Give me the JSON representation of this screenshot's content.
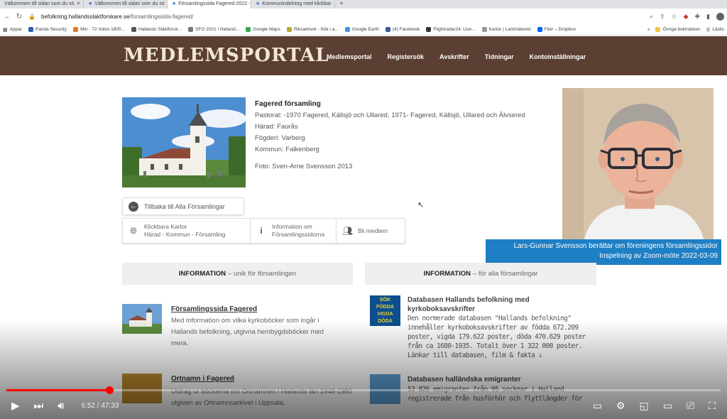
{
  "browser": {
    "tabs": [
      {
        "label": "Välkommen till sidan som du sö",
        "active": false
      },
      {
        "label": "Välkommen till sidan som du sö",
        "active": false
      },
      {
        "label": "Församlingssida Fagered-2022 -",
        "active": true
      },
      {
        "label": "Kommunindelning med klickbar",
        "active": false
      }
    ],
    "url_host": "befolkning.hallandsslaktforskare.se",
    "url_path": "/forsamlingssida-fagered/",
    "bookmarks": [
      "Appar",
      "Panda Security",
      "Min - 72 Volvo 1800...",
      "Hallands Släktforsk...",
      "SFO 2021 i Halland...",
      "Google Maps",
      "Riksarkivet - Sök i a...",
      "Google Earth",
      "(4) Facebook",
      "Flightradar24: Live...",
      "Kartor | Lantmäteriet",
      "Filer – Dropbox"
    ],
    "bookmarks_more": "»",
    "bookmarks_other": "Övriga bokmärken",
    "bookmarks_reading": "Läslis"
  },
  "site": {
    "logo": "MEDLEMSPORTAL",
    "nav": [
      "Medlemsportal",
      "Registersök",
      "Avskrifter",
      "Tidningar",
      "Kontoinställningar"
    ]
  },
  "parish": {
    "name": "Fagered församling",
    "pastorat": "Pastorat: -1970 Fagered, Källsjö och Ullared, 1971- Fagered, Källsjö, Ullared och Älvsered",
    "harad": "Härad: Faurås",
    "fogderi": "Fögderi: Varberg",
    "kommun": "Kommun: Falkenberg",
    "foto": "Foto: Sven-Arne Svensson 2013"
  },
  "buttons": {
    "back": "Tillbaka till Alla Församlingar",
    "maps_line1": "Klickbara Kartor",
    "maps_line2": "Härad - Kommun - Församling",
    "info_line1": "Information om",
    "info_line2": "Församlingssidorna",
    "member": "Bli medlem"
  },
  "presenter": {
    "caption_line1": "Lars-Gunnar Svensson berättar om föreningens församlingssidor",
    "caption_line2": "Inspelning av Zoom-möte 2022-03-09"
  },
  "columns": {
    "left_bold": "INFORMATION",
    "left_rest": "– unik för församlingen",
    "right_bold": "INFORMATION",
    "right_rest": "– för alla församlingar"
  },
  "left_items": [
    {
      "title": "Församlingssida Fagered",
      "desc": "Med information om vilka kyrkoböcker som ingår i Hallands befolkning, utgivna hembygdsböcker med mera."
    },
    {
      "title": "Ortnamn i Fagered ",
      "desc": "Utdrag ur böckerna om Ortnamnen i Hallands län 1948-1980 utgiven av Ortnamnsarkivet i Uppsala."
    }
  ],
  "right_items": [
    {
      "badge": [
        "SÖK",
        "FÖDDA",
        "VIGDA",
        "DÖDA"
      ],
      "title": "Databasen Hallands befolkning med kyrkoboksavskrifter",
      "desc": "Den normerade databasen \"Hallands befolkning\" innehåller kyrkoboksavskrifter av födda 672.209 poster, vigda 179.622 poster, döda 470.629 poster från ca 1680-1935. Totalt över 1 322 000 poster. Länkar till databasen, film & fakta ↓"
    },
    {
      "title": "Databasen halländska emigranter",
      "desc": "53 826 emigranter från 95 socknar i Halland registrerade från husförhör och flyttlängder för"
    }
  ],
  "player": {
    "time": "6:52 / 47:33",
    "progress_fraction": 0.144,
    "accent": "#ff0000"
  }
}
